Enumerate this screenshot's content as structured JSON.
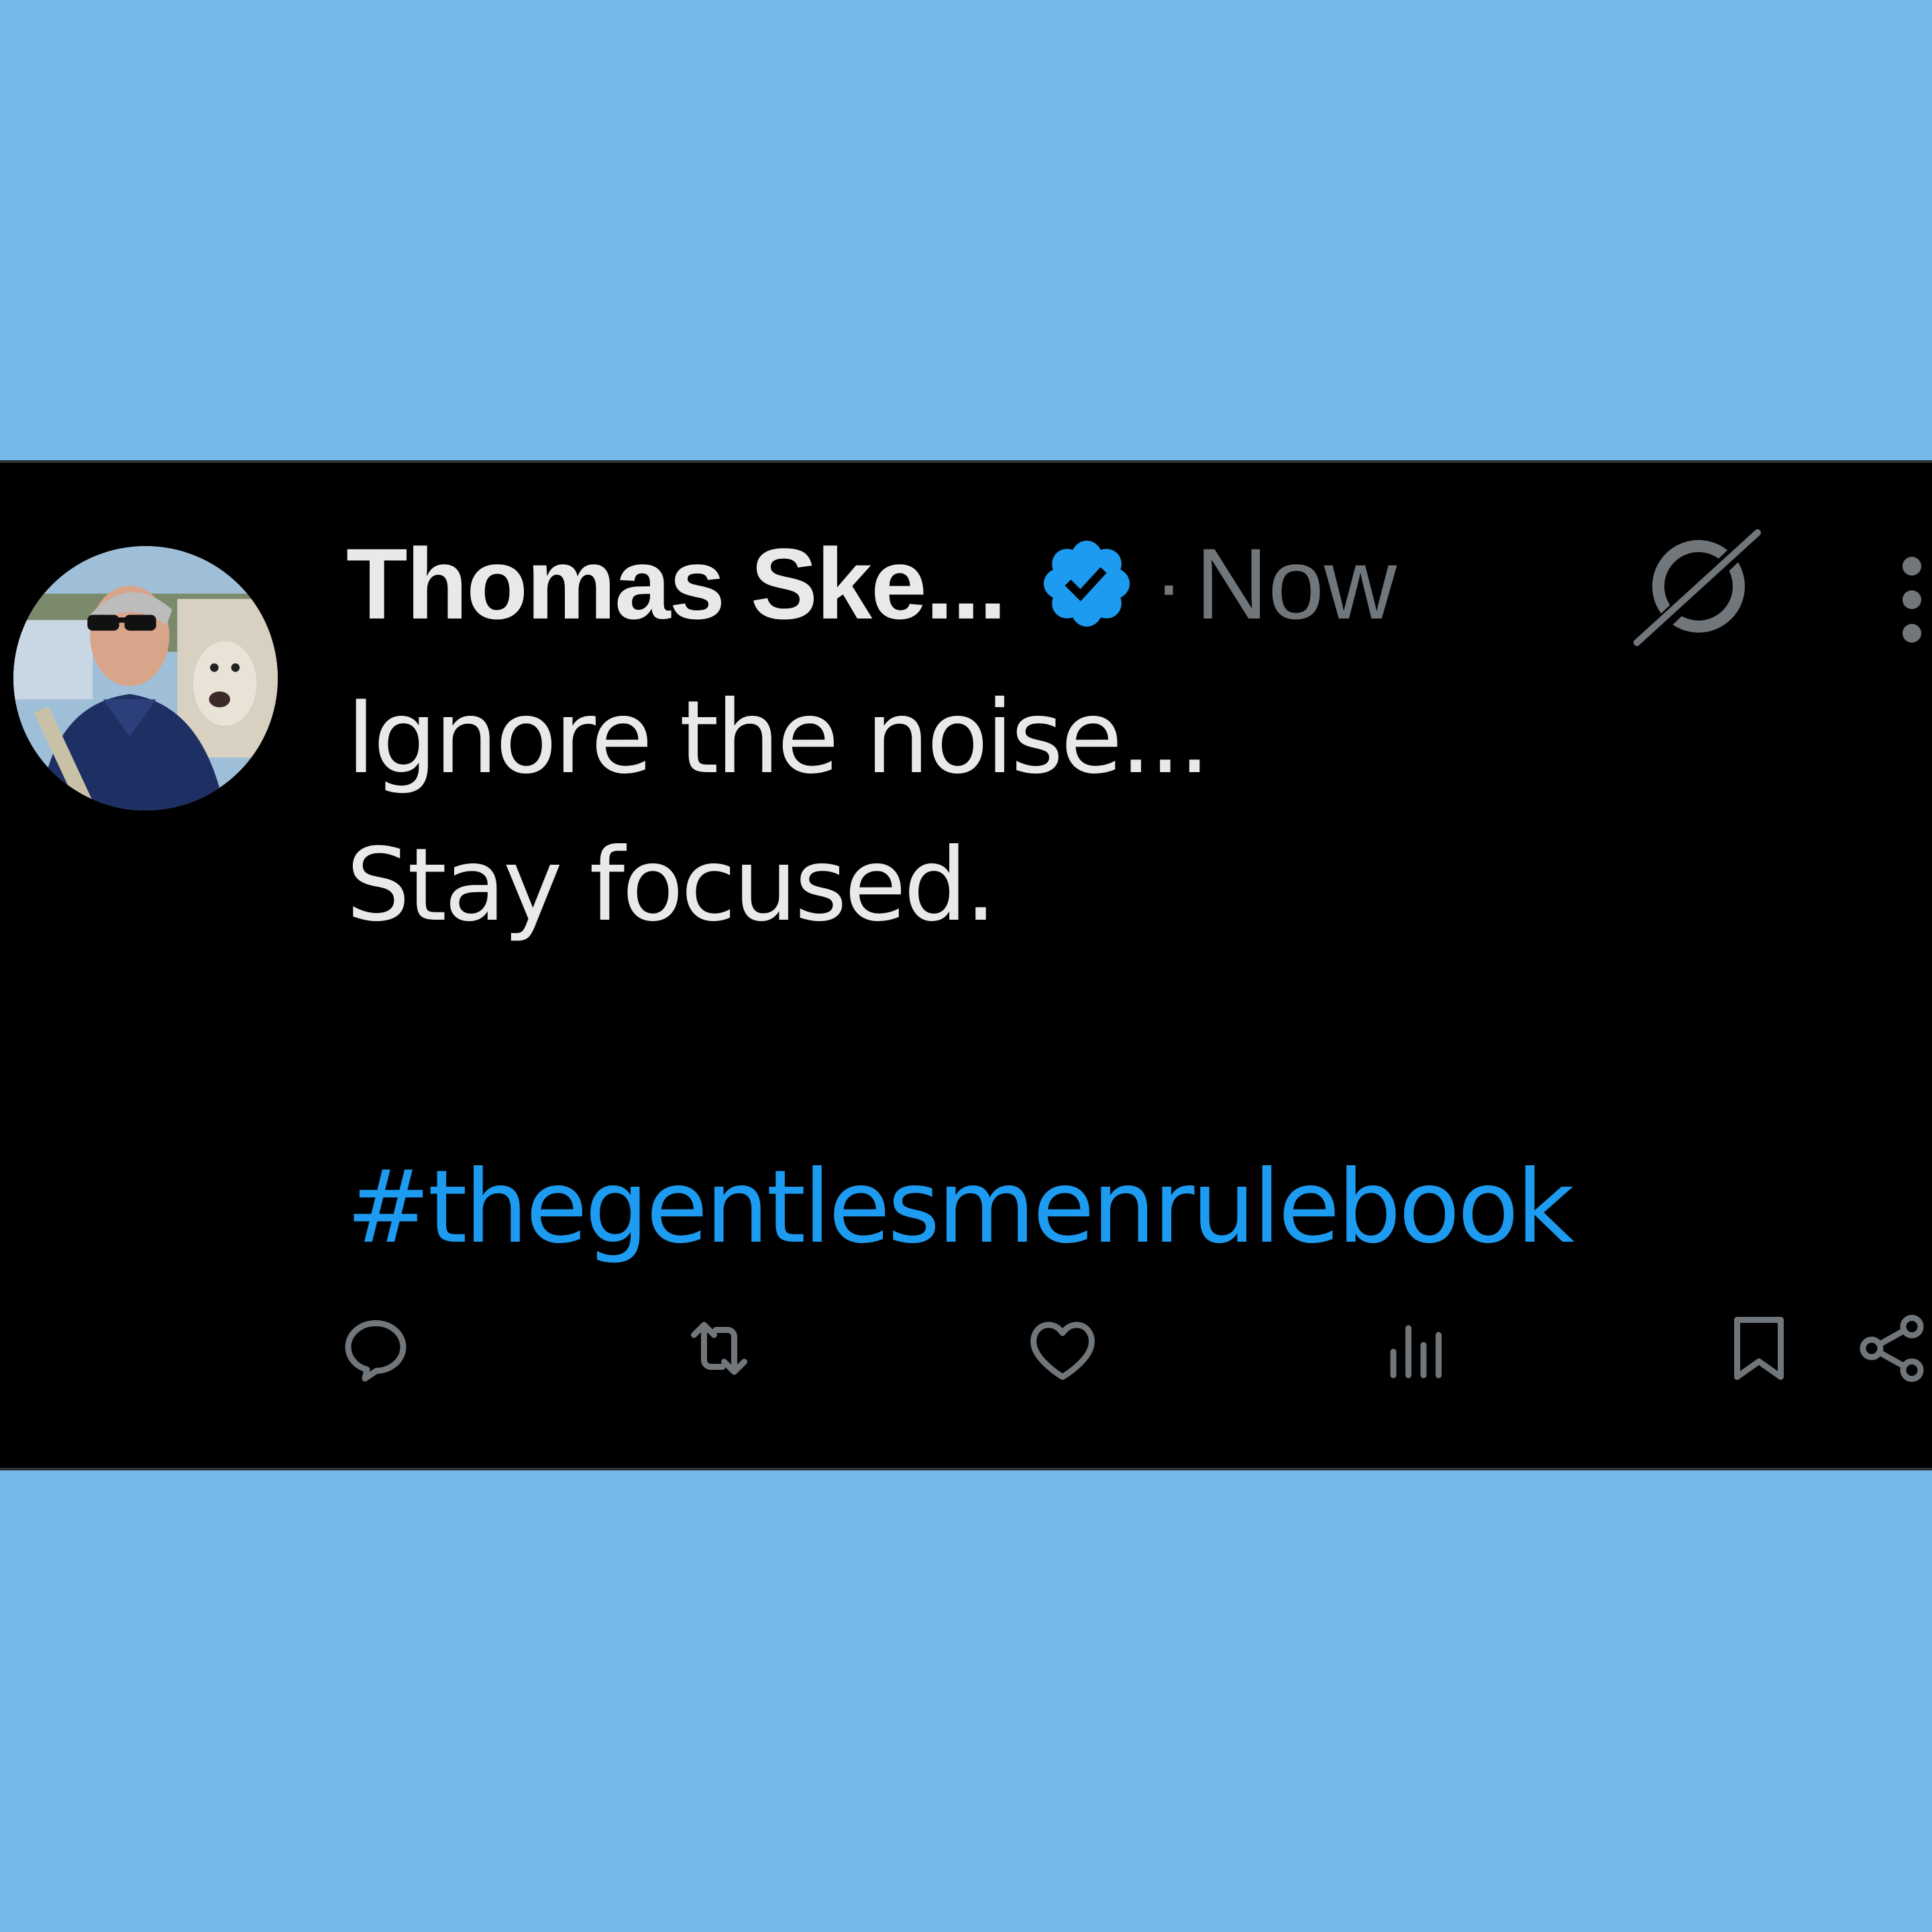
{
  "tweet": {
    "author_name": "Thomas Ske...",
    "separator": "·",
    "timestamp": "Now",
    "lines": [
      "Ignore the noise...",
      "Stay focused."
    ],
    "hashtag": "#thegentlesmenrulebook"
  },
  "icons": {
    "verified": "verified-badge-icon",
    "grok": "grok-icon",
    "more": "more-icon",
    "reply": "reply-icon",
    "retweet": "retweet-icon",
    "like": "like-icon",
    "views": "views-icon",
    "bookmark": "bookmark-icon",
    "share": "share-icon"
  },
  "colors": {
    "page_background": "#75b9eb",
    "card_background": "#000000",
    "text_primary": "#e7e9ea",
    "text_secondary": "#71767b",
    "accent": "#1d9bf0"
  }
}
